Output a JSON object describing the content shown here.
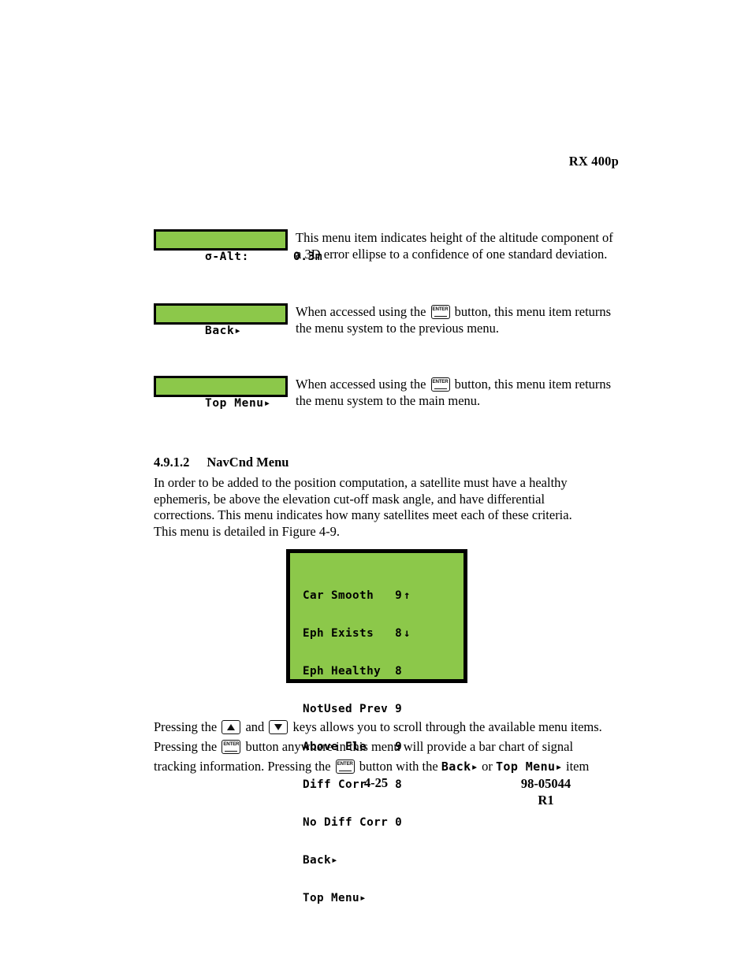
{
  "document": {
    "header_title": "RX 400p",
    "page_number": "4-25",
    "doc_number": "98-05044",
    "revision": "R1"
  },
  "menu_item_rows": [
    {
      "lcd_label": "σ-Alt:",
      "lcd_value": "0.3m",
      "lcd_full": "σ-Alt:      0.3m",
      "description": "This menu item indicates height of the altitude component of a 3D error ellipse to a confidence of one standard deviation."
    },
    {
      "lcd_label": "Back▸",
      "lcd_value": "",
      "lcd_full": "Back▸",
      "desc_part1": "When accessed using the",
      "desc_part2": "button, this menu item returns the menu system to the previous menu."
    },
    {
      "lcd_label": "Top Menu▸",
      "lcd_value": "",
      "lcd_full": "Top Menu▸",
      "desc_part1": "When accessed using the",
      "desc_part2": "button, this menu item returns the menu system to the main menu."
    }
  ],
  "section": {
    "number": "4.9.1.2",
    "title": "NavCnd Menu",
    "intro_paragraph": "In order to be added to the position computation, a satellite must have a healthy ephemeris, be above the elevation cut-off mask angle, and have differential corrections.  This menu indicates how many satellites meet each of these criteria.  This menu is detailed in Figure 4-9."
  },
  "figure": {
    "caption_reference": "Figure 4-9",
    "rows": [
      {
        "label": "Car Smooth",
        "value": "9",
        "scroll": "↑"
      },
      {
        "label": "Eph Exists",
        "value": "8",
        "scroll": "↓"
      },
      {
        "label": "Eph Healthy",
        "value": "8",
        "scroll": ""
      },
      {
        "label": "NotUsed Prev",
        "value": "9",
        "scroll": ""
      },
      {
        "label": "Above Ele",
        "value": "9",
        "scroll": ""
      },
      {
        "label": "Diff Corr",
        "value": "8",
        "scroll": ""
      },
      {
        "label": "No Diff Corr",
        "value": "0",
        "scroll": ""
      },
      {
        "label": "Back▸",
        "value": "",
        "scroll": ""
      },
      {
        "label": "Top Menu▸",
        "value": "",
        "scroll": ""
      }
    ],
    "line0": "Car Smooth   9",
    "line1": "Eph Exists   8",
    "line2": "Eph Healthy  8",
    "line3": "NotUsed Prev 9",
    "line4": "Above Ele    9",
    "line5": "Diff Corr    8",
    "line6": "No Diff Corr 0",
    "line7": "Back▸",
    "line8": "Top Menu▸",
    "scroll_up": "↑",
    "scroll_down": "↓"
  },
  "closing": {
    "t1": "Pressing the",
    "t2": "and",
    "t3": "keys allows you to scroll through the available menu items. Pressing the",
    "t4": "button anywhere in this menu will provide a bar chart of signal tracking information.  Pressing the",
    "t5": "button with the",
    "t6": "Back▸",
    "t7": "or",
    "t8": "Top Menu▸",
    "t9": "item"
  },
  "icons": {
    "enter_key": "enter-key-icon",
    "up_key": "arrow-up-key-icon",
    "down_key": "arrow-down-key-icon"
  },
  "colors": {
    "lcd_green": "#8CC84A",
    "lcd_border": "#000000",
    "text": "#000000",
    "page_background": "#FFFFFF"
  }
}
